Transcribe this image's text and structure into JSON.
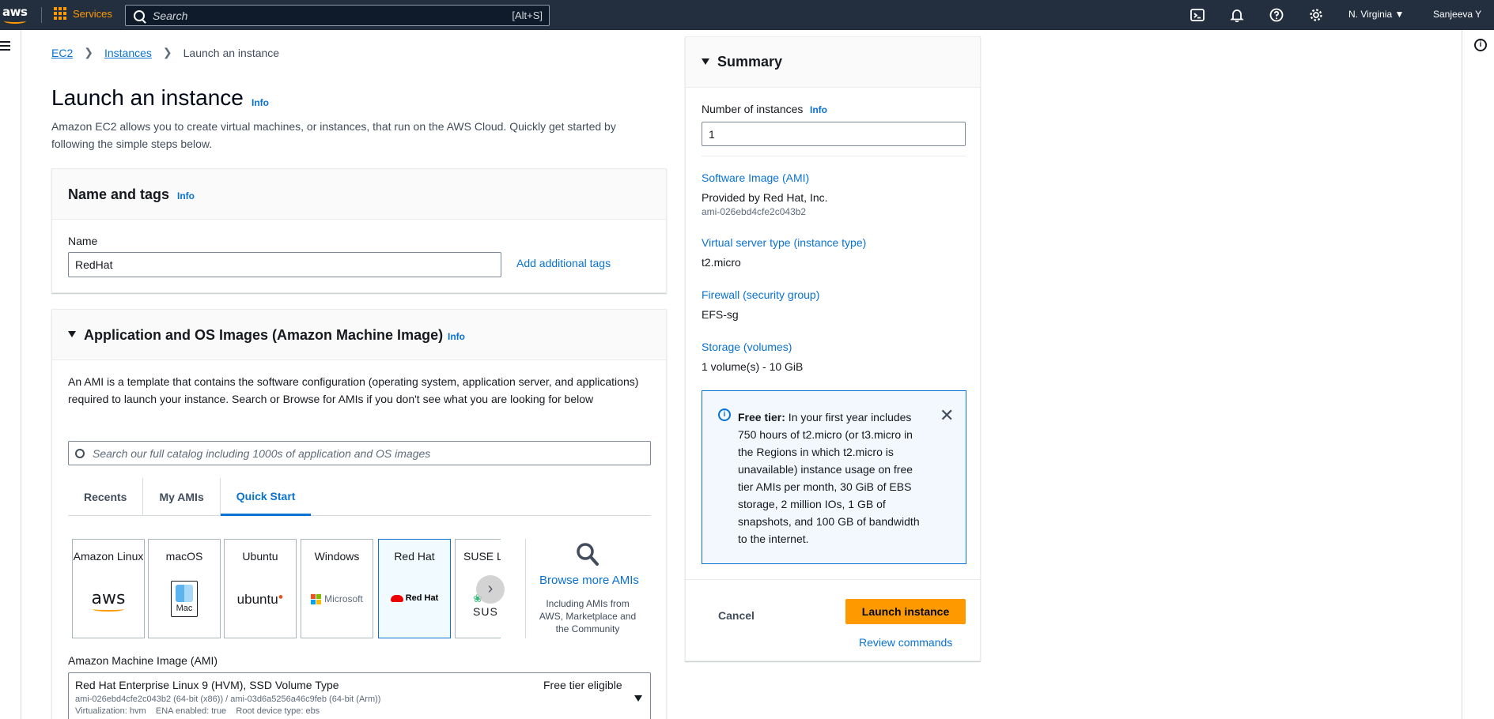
{
  "nav": {
    "logo_text": "aws",
    "services_label": "Services",
    "search_placeholder": "Search",
    "search_shortcut": "[Alt+S]",
    "region": "N. Virginia",
    "user": "Sanjeeva Y"
  },
  "breadcrumb": {
    "items": [
      "EC2",
      "Instances"
    ],
    "current": "Launch an instance"
  },
  "page": {
    "title": "Launch an instance",
    "info": "Info",
    "description": "Amazon EC2 allows you to create virtual machines, or instances, that run on the AWS Cloud. Quickly get started by following the simple steps below."
  },
  "name_tags": {
    "title": "Name and tags",
    "info": "Info",
    "name_label": "Name",
    "name_value": "RedHat",
    "add_tags": "Add additional tags"
  },
  "ami": {
    "title": "Application and OS Images (Amazon Machine Image)",
    "info": "Info",
    "description": "An AMI is a template that contains the software configuration (operating system, application server, and applications) required to launch your instance. Search or Browse for AMIs if you don't see what you are looking for below",
    "search_placeholder": "Search our full catalog including 1000s of application and OS images",
    "tabs": [
      "Recents",
      "My AMIs",
      "Quick Start"
    ],
    "tiles": [
      {
        "name": "Amazon Linux",
        "logo": "aws"
      },
      {
        "name": "macOS",
        "logo": "Mac"
      },
      {
        "name": "Ubuntu",
        "logo": "ubuntu"
      },
      {
        "name": "Windows",
        "logo": "Microsoft"
      },
      {
        "name": "Red Hat",
        "logo": "Red Hat"
      },
      {
        "name": "SUSE Li",
        "logo": "SUS"
      }
    ],
    "browse_more": "Browse more AMIs",
    "browse_sub": "Including AMIs from AWS, Marketplace and the Community",
    "ami_label": "Amazon Machine Image (AMI)",
    "selected_name": "Red Hat Enterprise Linux 9 (HVM), SSD Volume Type",
    "selected_ids": "ami-026ebd4cfe2c043b2 (64-bit (x86)) / ami-03d6a5256a46c9feb (64-bit (Arm))",
    "selected_meta": "Virtualization: hvm    ENA enabled: true    Root device type: ebs",
    "free_tier": "Free tier eligible"
  },
  "summary": {
    "title": "Summary",
    "num_label": "Number of instances",
    "info": "Info",
    "num_value": "1",
    "software_label": "Software Image (AMI)",
    "software_value": "Provided by Red Hat, Inc.",
    "software_id": "ami-026ebd4cfe2c043b2",
    "type_label": "Virtual server type (instance type)",
    "type_value": "t2.micro",
    "firewall_label": "Firewall (security group)",
    "firewall_value": "EFS-sg",
    "storage_label": "Storage (volumes)",
    "storage_value": "1 volume(s) - 10 GiB",
    "free_tier_title": "Free tier:",
    "free_tier_text": " In your first year includes 750 hours of t2.micro (or t3.micro in the Regions in which t2.micro is unavailable) instance usage on free tier AMIs per month, 30 GiB of EBS storage, 2 million IOs, 1 GB of snapshots, and 100 GB of bandwidth to the internet.",
    "cancel": "Cancel",
    "launch": "Launch instance",
    "review": "Review commands"
  }
}
